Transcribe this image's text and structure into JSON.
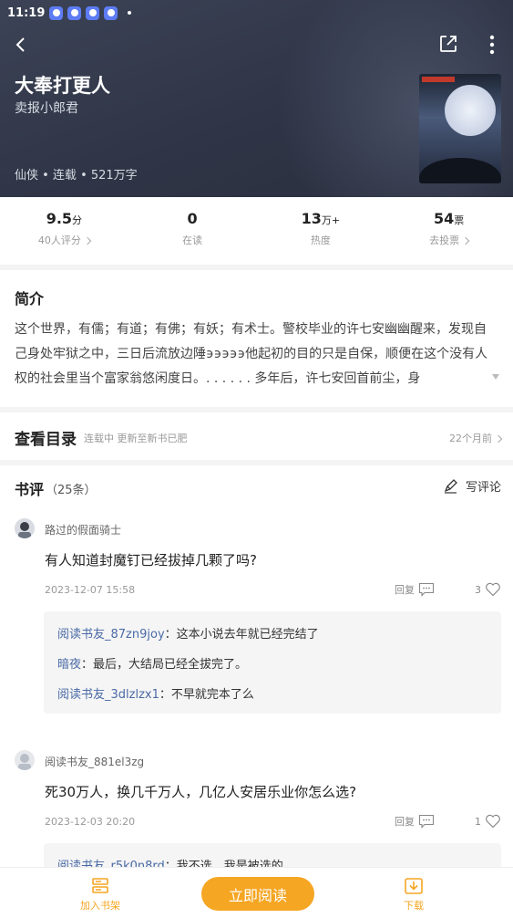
{
  "status_bar": {
    "time": "11:19"
  },
  "book": {
    "title": "大奉打更人",
    "author": "卖报小郎君",
    "meta": "仙侠 • 连载 • 521万字"
  },
  "stats": [
    {
      "value": "9.5",
      "unit": "分",
      "label": "40人评分",
      "chevron": true
    },
    {
      "value": "0",
      "unit": "",
      "label": "在读",
      "chevron": false
    },
    {
      "value": "13",
      "unit": "万+",
      "label": "热度",
      "chevron": false
    },
    {
      "value": "54",
      "unit": "票",
      "label": "去投票",
      "chevron": true
    }
  ],
  "intro": {
    "title": "简介",
    "text": "这个世界，有儒；有道；有佛；有妖；有术士。警校毕业的许七安幽幽醒来，发现自己身处牢狱之中，三日后流放边陲϶϶϶϶϶他起初的目的只是自保，顺便在这个没有人权的社会里当个富家翁悠闲度日。. . . . . . 多年后，许七安回首前尘，身"
  },
  "catalog": {
    "title": "查看目录",
    "status": "连载中 更新至新书已肥",
    "time": "22个月前"
  },
  "reviews": {
    "title": "书评",
    "count": "（25条）",
    "write_label": "写评论",
    "items": [
      {
        "user": "路过的假面骑士",
        "text": "有人知道封魔钉已经拔掉几颗了吗?",
        "date": "2023-12-07 15:58",
        "reply_label": "回复",
        "likes": "3",
        "replies": [
          {
            "name": "阅读书友_87zn9joy",
            "text": "：这本小说去年就已经完结了"
          },
          {
            "name": "暗夜",
            "text": "：最后，大结局已经全拔完了。"
          },
          {
            "name": "阅读书友_3dlzlzx1",
            "text": "：不早就完本了么"
          }
        ]
      },
      {
        "user": "阅读书友_881el3zg",
        "text": "死30万人，换几千万人，几亿人安居乐业你怎么选?",
        "date": "2023-12-03 20:20",
        "reply_label": "回复",
        "likes": "1",
        "replies": [
          {
            "name": "阅读书友_r5k0n8rd",
            "text": "：我不选，我是被选的"
          }
        ]
      }
    ]
  },
  "bottom_bar": {
    "shelf_label": "加入书架",
    "read_label": "立即阅读",
    "download_label": "下载"
  },
  "colors": {
    "accent": "#f5a623",
    "link": "#4a6aa6",
    "header_bg": "#343a4c"
  },
  "icons": [
    "back-icon",
    "share-icon",
    "more-icon",
    "edit-icon",
    "comment-icon",
    "heart-icon",
    "bookshelf-icon",
    "download-icon"
  ]
}
